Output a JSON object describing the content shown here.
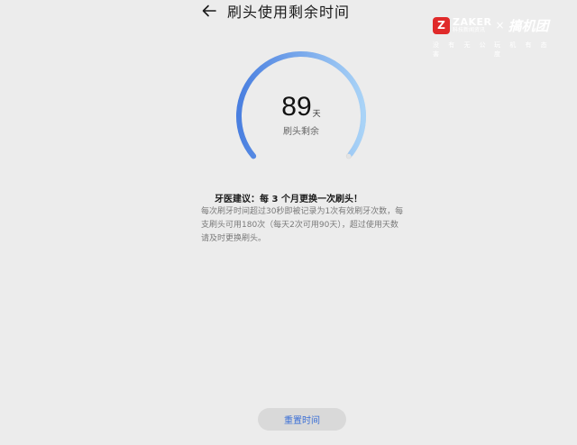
{
  "header": {
    "title": "刷头使用剩余时间",
    "back_icon": "arrow-left-icon"
  },
  "watermark": {
    "badge_letter": "Z",
    "zaker_name": "ZAKER",
    "zaker_sub": "科技新闻资讯",
    "cross": "×",
    "brand": "搞机团",
    "slogan_left": "没 有 无 公 害",
    "slogan_right": "玩 机 有 态 度"
  },
  "gauge": {
    "value": "89",
    "unit": "天",
    "caption": "刷头剩余",
    "remaining_days": 89,
    "total_days": 90,
    "colors": {
      "arc_start": "#4a7fe0",
      "arc_end": "#a9d3f7",
      "track": "#d6d6d6"
    }
  },
  "advice": {
    "title": "牙医建议：每 3 个月更换一次刷头！",
    "body": "每次刷牙时间超过30秒即被记录为1次有效刷牙次数，每支刷头可用180次（每天2次可用90天），超过使用天数请及时更换刷头。"
  },
  "actions": {
    "reset_label": "重置时间"
  }
}
